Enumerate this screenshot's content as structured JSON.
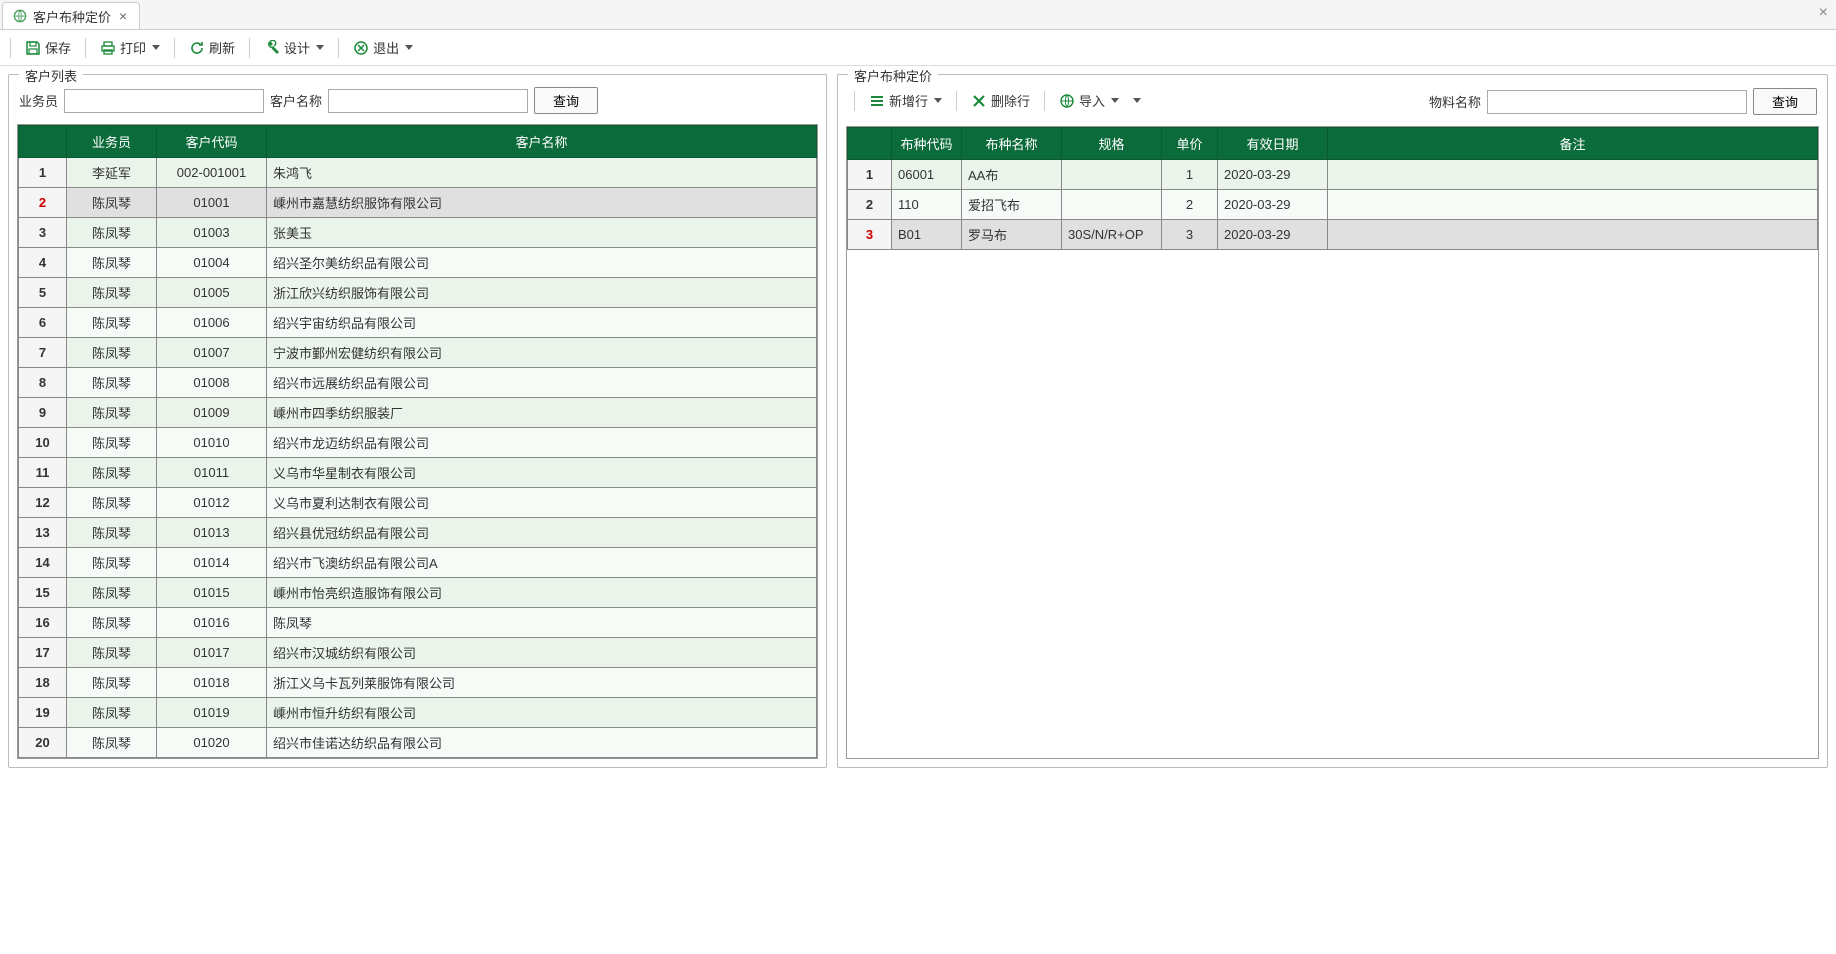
{
  "tab": {
    "title": "客户布种定价"
  },
  "toolbar": {
    "save": "保存",
    "print": "打印",
    "refresh": "刷新",
    "design": "设计",
    "exit": "退出"
  },
  "left_panel": {
    "title": "客户列表",
    "label_sales": "业务员",
    "label_custname": "客户名称",
    "query": "查询",
    "columns": {
      "sales": "业务员",
      "code": "客户代码",
      "name": "客户名称"
    },
    "selected_index": 2,
    "rows": [
      {
        "n": "1",
        "sales": "李延军",
        "code": "002-001001",
        "name": "朱鸿飞"
      },
      {
        "n": "2",
        "sales": "陈凤琴",
        "code": "01001",
        "name": "嵊州市嘉慧纺织服饰有限公司"
      },
      {
        "n": "3",
        "sales": "陈凤琴",
        "code": "01003",
        "name": "张美玉"
      },
      {
        "n": "4",
        "sales": "陈凤琴",
        "code": "01004",
        "name": "绍兴圣尔美纺织品有限公司"
      },
      {
        "n": "5",
        "sales": "陈凤琴",
        "code": "01005",
        "name": "浙江欣兴纺织服饰有限公司"
      },
      {
        "n": "6",
        "sales": "陈凤琴",
        "code": "01006",
        "name": "绍兴宇宙纺织品有限公司"
      },
      {
        "n": "7",
        "sales": "陈凤琴",
        "code": "01007",
        "name": "宁波市鄞州宏健纺织有限公司"
      },
      {
        "n": "8",
        "sales": "陈凤琴",
        "code": "01008",
        "name": "绍兴市远展纺织品有限公司"
      },
      {
        "n": "9",
        "sales": "陈凤琴",
        "code": "01009",
        "name": "嵊州市四季纺织服装厂"
      },
      {
        "n": "10",
        "sales": "陈凤琴",
        "code": "01010",
        "name": "绍兴市龙迈纺织品有限公司"
      },
      {
        "n": "11",
        "sales": "陈凤琴",
        "code": "01011",
        "name": "义乌市华星制衣有限公司"
      },
      {
        "n": "12",
        "sales": "陈凤琴",
        "code": "01012",
        "name": "义乌市夏利达制衣有限公司"
      },
      {
        "n": "13",
        "sales": "陈凤琴",
        "code": "01013",
        "name": "绍兴县优冠纺织品有限公司"
      },
      {
        "n": "14",
        "sales": "陈凤琴",
        "code": "01014",
        "name": "绍兴市飞澳纺织品有限公司A"
      },
      {
        "n": "15",
        "sales": "陈凤琴",
        "code": "01015",
        "name": "嵊州市怡亮织造服饰有限公司"
      },
      {
        "n": "16",
        "sales": "陈凤琴",
        "code": "01016",
        "name": "陈凤琴"
      },
      {
        "n": "17",
        "sales": "陈凤琴",
        "code": "01017",
        "name": "绍兴市汉城纺织有限公司"
      },
      {
        "n": "18",
        "sales": "陈凤琴",
        "code": "01018",
        "name": "浙江义乌卡瓦列莱服饰有限公司"
      },
      {
        "n": "19",
        "sales": "陈凤琴",
        "code": "01019",
        "name": "嵊州市恒升纺织有限公司"
      },
      {
        "n": "20",
        "sales": "陈凤琴",
        "code": "01020",
        "name": "绍兴市佳诺达纺织品有限公司"
      }
    ]
  },
  "right_panel": {
    "title": "客户布种定价",
    "add_row": "新增行",
    "del_row": "删除行",
    "import": "导入",
    "label_material": "物料名称",
    "query": "查询",
    "columns": {
      "code": "布种代码",
      "name": "布种名称",
      "spec": "规格",
      "price": "单价",
      "date": "有效日期",
      "remark": "备注"
    },
    "selected_index": 3,
    "rows": [
      {
        "n": "1",
        "code": "06001",
        "name": "AA布",
        "spec": "",
        "price": "1",
        "date": "2020-03-29",
        "remark": ""
      },
      {
        "n": "2",
        "code": "110",
        "name": "爱招飞布",
        "spec": "",
        "price": "2",
        "date": "2020-03-29",
        "remark": ""
      },
      {
        "n": "3",
        "code": "B01",
        "name": "罗马布",
        "spec": "30S/N/R+OP",
        "price": "3",
        "date": "2020-03-29",
        "remark": ""
      }
    ]
  }
}
